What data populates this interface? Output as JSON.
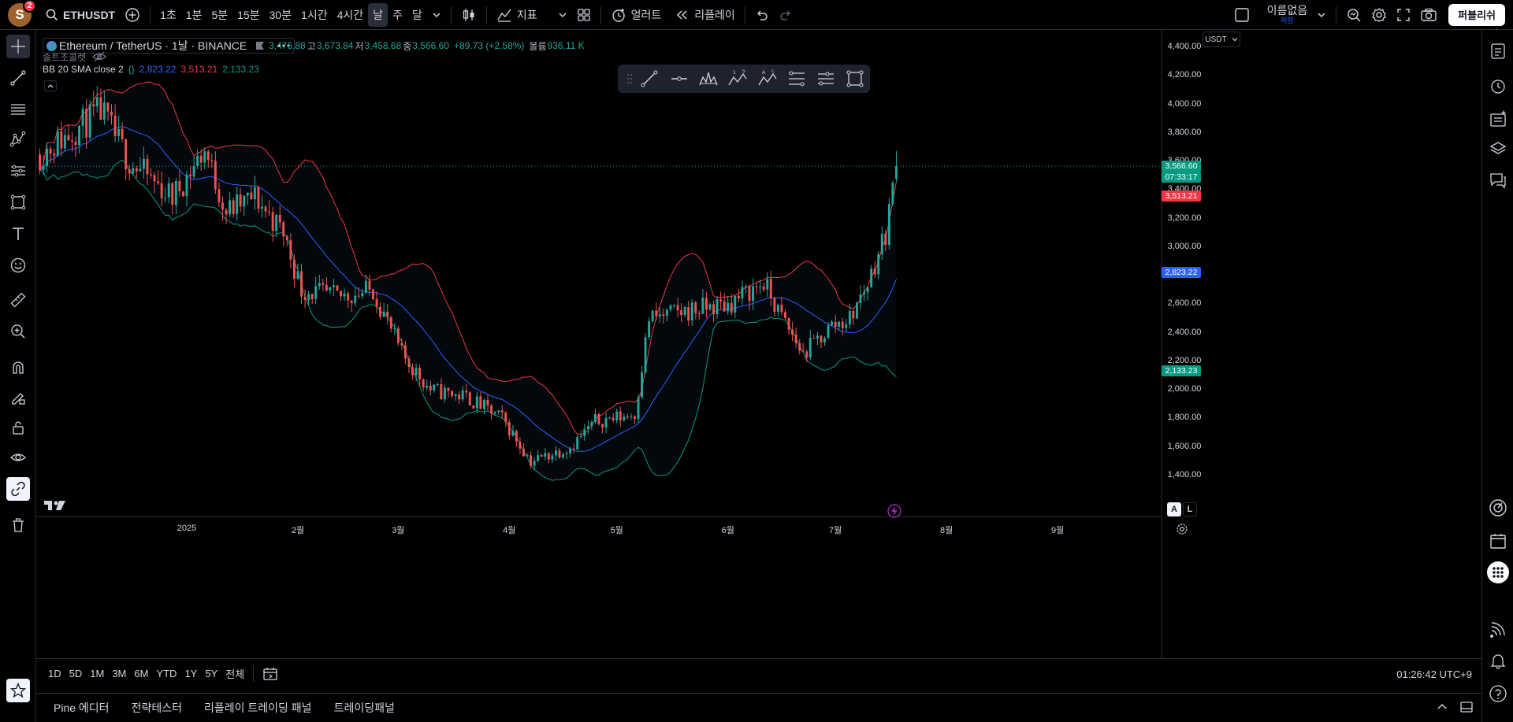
{
  "topbar": {
    "avatar_letter": "S",
    "notification_count": "2",
    "symbol": "ETHUSDT",
    "intervals": [
      "1초",
      "1분",
      "5분",
      "15분",
      "30분",
      "1시간",
      "4시간",
      "날",
      "주",
      "달"
    ],
    "active_interval": "날",
    "indicators_label": "지표",
    "alert_label": "얼러트",
    "replay_label": "리플레이",
    "layout_name": "이름없음",
    "layout_status": "저장",
    "publish_label": "퍼블리쉬"
  },
  "legend": {
    "title": "Ethereum / TetherUS · 1날 · BINANCE",
    "open_key": "",
    "open": "3,476.88",
    "high_key": "고",
    "high": "3,673.84",
    "low_key": "저",
    "low": "3,458.68",
    "close_key": "종",
    "close": "3,566.60",
    "change": "+89.73 (+2.58%)",
    "volume_key": "볼륨",
    "volume": "936.11 K",
    "sub_legend": "솔트조콜렛",
    "bb_name": "BB 20 SMA close 2",
    "bb_basis": "2,823.22",
    "bb_upper": "3,513.21",
    "bb_lower": "2,133.23"
  },
  "price_axis": {
    "currency": "USDT",
    "ticks": [
      "4,400.00",
      "4,200.00",
      "4,000.00",
      "3,800.00",
      "3,600.00",
      "3,400.00",
      "3,200.00",
      "3,000.00",
      "2,800.00",
      "2,600.00",
      "2,400.00",
      "2,200.00",
      "2,000.00",
      "1,800.00",
      "1,600.00",
      "1,400.00"
    ],
    "last_price": "3,566.60",
    "countdown": "07:33:17",
    "upper_label": "3,513.21",
    "basis_label": "2,823.22",
    "lower_label": "2,133.23"
  },
  "time_axis": {
    "labels": [
      "2025",
      "2월",
      "3월",
      "4월",
      "5월",
      "6월",
      "7월",
      "8월",
      "9월"
    ]
  },
  "scale_buttons": {
    "auto": "A",
    "log": "L"
  },
  "range_bar": {
    "ranges": [
      "1D",
      "5D",
      "1M",
      "3M",
      "6M",
      "YTD",
      "1Y",
      "5Y",
      "전체"
    ],
    "clock": "01:26:42 UTC+9"
  },
  "bottom_panel": {
    "tabs": [
      "Pine 에디터",
      "전략테스터",
      "리플레이 트레이딩 패널",
      "트레이딩패널"
    ]
  },
  "colors": {
    "up": "#26a69a",
    "down": "#ef5350",
    "bb_upper": "#f23645",
    "bb_basis": "#2962ff",
    "bb_lower": "#089981",
    "background": "#000000"
  },
  "chart_data": {
    "type": "candlestick",
    "symbol": "ETHUSDT",
    "interval": "1D",
    "ylim": [
      1300,
      4450
    ],
    "x_range": [
      "2024-11-20",
      "2025-09-30"
    ],
    "anchors": [
      [
        "2024-11-21",
        3650
      ],
      [
        "2024-12-08",
        3950
      ],
      [
        "2024-12-16",
        3600
      ],
      [
        "2024-12-28",
        3350
      ],
      [
        "2025-01-06",
        3680
      ],
      [
        "2025-01-12",
        3250
      ],
      [
        "2025-01-20",
        3350
      ],
      [
        "2025-01-28",
        3100
      ],
      [
        "2025-02-02",
        2700
      ],
      [
        "2025-02-12",
        2650
      ],
      [
        "2025-02-22",
        2700
      ],
      [
        "2025-03-02",
        2250
      ],
      [
        "2025-03-10",
        2000
      ],
      [
        "2025-03-20",
        1950
      ],
      [
        "2025-03-30",
        1800
      ],
      [
        "2025-04-07",
        1500
      ],
      [
        "2025-04-18",
        1600
      ],
      [
        "2025-04-25",
        1780
      ],
      [
        "2025-05-06",
        1830
      ],
      [
        "2025-05-10",
        2500
      ],
      [
        "2025-05-20",
        2550
      ],
      [
        "2025-06-01",
        2600
      ],
      [
        "2025-06-11",
        2750
      ],
      [
        "2025-06-15",
        2550
      ],
      [
        "2025-06-22",
        2250
      ],
      [
        "2025-06-30",
        2450
      ],
      [
        "2025-07-05",
        2500
      ],
      [
        "2025-07-10",
        2750
      ],
      [
        "2025-07-15",
        3100
      ],
      [
        "2025-07-18",
        3566
      ]
    ],
    "last_ohlc": {
      "open": 3476.88,
      "high": 3673.84,
      "low": 3458.68,
      "close": 3566.6
    },
    "bollinger": {
      "period": 20,
      "mult": 2,
      "basis": 2823.22,
      "upper": 3513.21,
      "lower": 2133.23
    }
  }
}
